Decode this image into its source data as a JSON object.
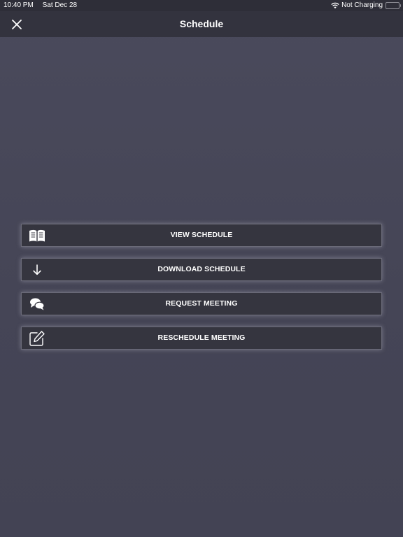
{
  "status_bar": {
    "time": "10:40 PM",
    "date": "Sat Dec 28",
    "charging": "Not Charging"
  },
  "nav": {
    "title": "Schedule",
    "close_icon": "close-icon"
  },
  "menu": {
    "items": [
      {
        "label": "VIEW SCHEDULE",
        "icon": "book-icon"
      },
      {
        "label": "DOWNLOAD SCHEDULE",
        "icon": "arrow-down-icon"
      },
      {
        "label": "REQUEST MEETING",
        "icon": "chat-bubbles-icon"
      },
      {
        "label": "RESCHEDULE MEETING",
        "icon": "edit-icon"
      }
    ]
  },
  "colors": {
    "background": "#464657",
    "nav_bar": "#33333e",
    "button": "#35353f",
    "text": "#ffffff"
  }
}
